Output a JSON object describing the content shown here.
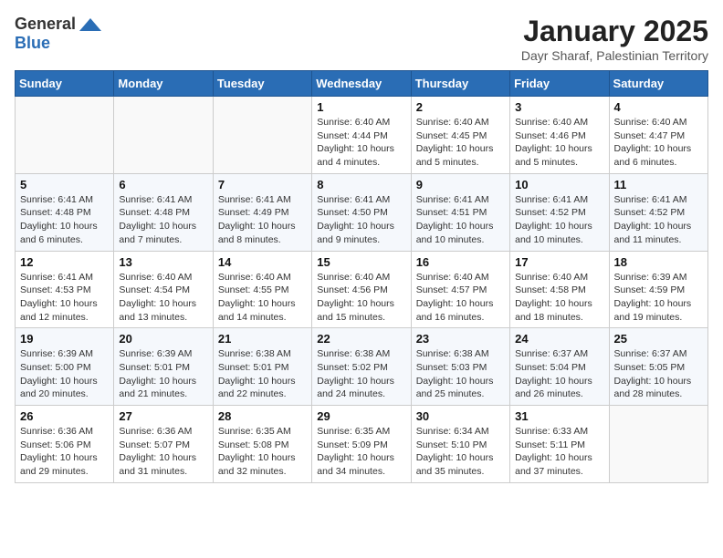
{
  "header": {
    "logo_general": "General",
    "logo_blue": "Blue",
    "month_title": "January 2025",
    "subtitle": "Dayr Sharaf, Palestinian Territory"
  },
  "weekdays": [
    "Sunday",
    "Monday",
    "Tuesday",
    "Wednesday",
    "Thursday",
    "Friday",
    "Saturday"
  ],
  "weeks": [
    [
      {
        "day": "",
        "info": ""
      },
      {
        "day": "",
        "info": ""
      },
      {
        "day": "",
        "info": ""
      },
      {
        "day": "1",
        "info": "Sunrise: 6:40 AM\nSunset: 4:44 PM\nDaylight: 10 hours\nand 4 minutes."
      },
      {
        "day": "2",
        "info": "Sunrise: 6:40 AM\nSunset: 4:45 PM\nDaylight: 10 hours\nand 5 minutes."
      },
      {
        "day": "3",
        "info": "Sunrise: 6:40 AM\nSunset: 4:46 PM\nDaylight: 10 hours\nand 5 minutes."
      },
      {
        "day": "4",
        "info": "Sunrise: 6:40 AM\nSunset: 4:47 PM\nDaylight: 10 hours\nand 6 minutes."
      }
    ],
    [
      {
        "day": "5",
        "info": "Sunrise: 6:41 AM\nSunset: 4:48 PM\nDaylight: 10 hours\nand 6 minutes."
      },
      {
        "day": "6",
        "info": "Sunrise: 6:41 AM\nSunset: 4:48 PM\nDaylight: 10 hours\nand 7 minutes."
      },
      {
        "day": "7",
        "info": "Sunrise: 6:41 AM\nSunset: 4:49 PM\nDaylight: 10 hours\nand 8 minutes."
      },
      {
        "day": "8",
        "info": "Sunrise: 6:41 AM\nSunset: 4:50 PM\nDaylight: 10 hours\nand 9 minutes."
      },
      {
        "day": "9",
        "info": "Sunrise: 6:41 AM\nSunset: 4:51 PM\nDaylight: 10 hours\nand 10 minutes."
      },
      {
        "day": "10",
        "info": "Sunrise: 6:41 AM\nSunset: 4:52 PM\nDaylight: 10 hours\nand 10 minutes."
      },
      {
        "day": "11",
        "info": "Sunrise: 6:41 AM\nSunset: 4:52 PM\nDaylight: 10 hours\nand 11 minutes."
      }
    ],
    [
      {
        "day": "12",
        "info": "Sunrise: 6:41 AM\nSunset: 4:53 PM\nDaylight: 10 hours\nand 12 minutes."
      },
      {
        "day": "13",
        "info": "Sunrise: 6:40 AM\nSunset: 4:54 PM\nDaylight: 10 hours\nand 13 minutes."
      },
      {
        "day": "14",
        "info": "Sunrise: 6:40 AM\nSunset: 4:55 PM\nDaylight: 10 hours\nand 14 minutes."
      },
      {
        "day": "15",
        "info": "Sunrise: 6:40 AM\nSunset: 4:56 PM\nDaylight: 10 hours\nand 15 minutes."
      },
      {
        "day": "16",
        "info": "Sunrise: 6:40 AM\nSunset: 4:57 PM\nDaylight: 10 hours\nand 16 minutes."
      },
      {
        "day": "17",
        "info": "Sunrise: 6:40 AM\nSunset: 4:58 PM\nDaylight: 10 hours\nand 18 minutes."
      },
      {
        "day": "18",
        "info": "Sunrise: 6:39 AM\nSunset: 4:59 PM\nDaylight: 10 hours\nand 19 minutes."
      }
    ],
    [
      {
        "day": "19",
        "info": "Sunrise: 6:39 AM\nSunset: 5:00 PM\nDaylight: 10 hours\nand 20 minutes."
      },
      {
        "day": "20",
        "info": "Sunrise: 6:39 AM\nSunset: 5:01 PM\nDaylight: 10 hours\nand 21 minutes."
      },
      {
        "day": "21",
        "info": "Sunrise: 6:38 AM\nSunset: 5:01 PM\nDaylight: 10 hours\nand 22 minutes."
      },
      {
        "day": "22",
        "info": "Sunrise: 6:38 AM\nSunset: 5:02 PM\nDaylight: 10 hours\nand 24 minutes."
      },
      {
        "day": "23",
        "info": "Sunrise: 6:38 AM\nSunset: 5:03 PM\nDaylight: 10 hours\nand 25 minutes."
      },
      {
        "day": "24",
        "info": "Sunrise: 6:37 AM\nSunset: 5:04 PM\nDaylight: 10 hours\nand 26 minutes."
      },
      {
        "day": "25",
        "info": "Sunrise: 6:37 AM\nSunset: 5:05 PM\nDaylight: 10 hours\nand 28 minutes."
      }
    ],
    [
      {
        "day": "26",
        "info": "Sunrise: 6:36 AM\nSunset: 5:06 PM\nDaylight: 10 hours\nand 29 minutes."
      },
      {
        "day": "27",
        "info": "Sunrise: 6:36 AM\nSunset: 5:07 PM\nDaylight: 10 hours\nand 31 minutes."
      },
      {
        "day": "28",
        "info": "Sunrise: 6:35 AM\nSunset: 5:08 PM\nDaylight: 10 hours\nand 32 minutes."
      },
      {
        "day": "29",
        "info": "Sunrise: 6:35 AM\nSunset: 5:09 PM\nDaylight: 10 hours\nand 34 minutes."
      },
      {
        "day": "30",
        "info": "Sunrise: 6:34 AM\nSunset: 5:10 PM\nDaylight: 10 hours\nand 35 minutes."
      },
      {
        "day": "31",
        "info": "Sunrise: 6:33 AM\nSunset: 5:11 PM\nDaylight: 10 hours\nand 37 minutes."
      },
      {
        "day": "",
        "info": ""
      }
    ]
  ]
}
